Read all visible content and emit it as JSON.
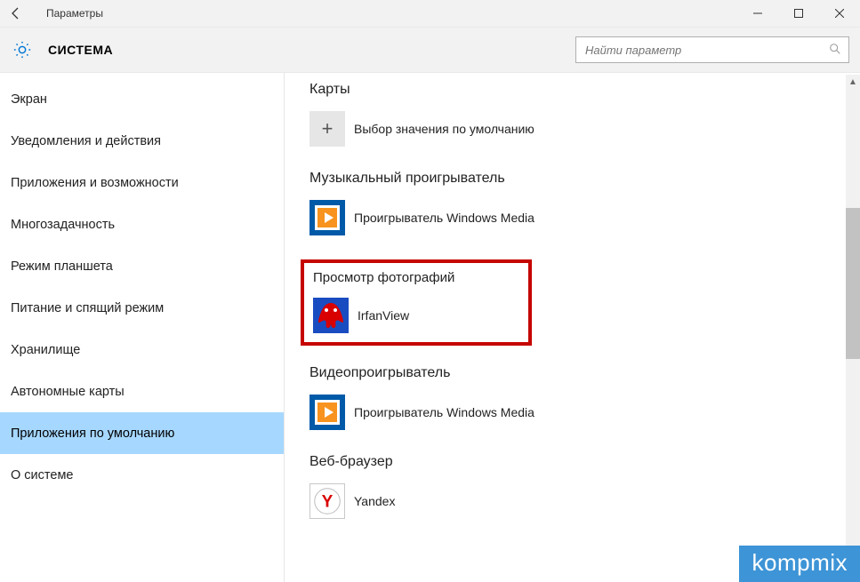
{
  "window": {
    "title": "Параметры"
  },
  "header": {
    "title": "СИСТЕМА"
  },
  "search": {
    "placeholder": "Найти параметр"
  },
  "sidebar": {
    "items": [
      {
        "label": "Экран",
        "selected": false
      },
      {
        "label": "Уведомления и действия",
        "selected": false
      },
      {
        "label": "Приложения и возможности",
        "selected": false
      },
      {
        "label": "Многозадачность",
        "selected": false
      },
      {
        "label": "Режим планшета",
        "selected": false
      },
      {
        "label": "Питание и спящий режим",
        "selected": false
      },
      {
        "label": "Хранилище",
        "selected": false
      },
      {
        "label": "Автономные карты",
        "selected": false
      },
      {
        "label": "Приложения по умолчанию",
        "selected": true
      },
      {
        "label": "О системе",
        "selected": false
      }
    ]
  },
  "defaults": {
    "maps": {
      "title": "Карты",
      "app": "Выбор значения по умолчанию"
    },
    "music": {
      "title": "Музыкальный проигрыватель",
      "app": "Проигрыватель Windows Media"
    },
    "photos": {
      "title": "Просмотр фотографий",
      "app": "IrfanView"
    },
    "video": {
      "title": "Видеопроигрыватель",
      "app": "Проигрыватель Windows Media"
    },
    "browser": {
      "title": "Веб-браузер",
      "app": "Yandex"
    }
  },
  "watermark": "kompmix"
}
